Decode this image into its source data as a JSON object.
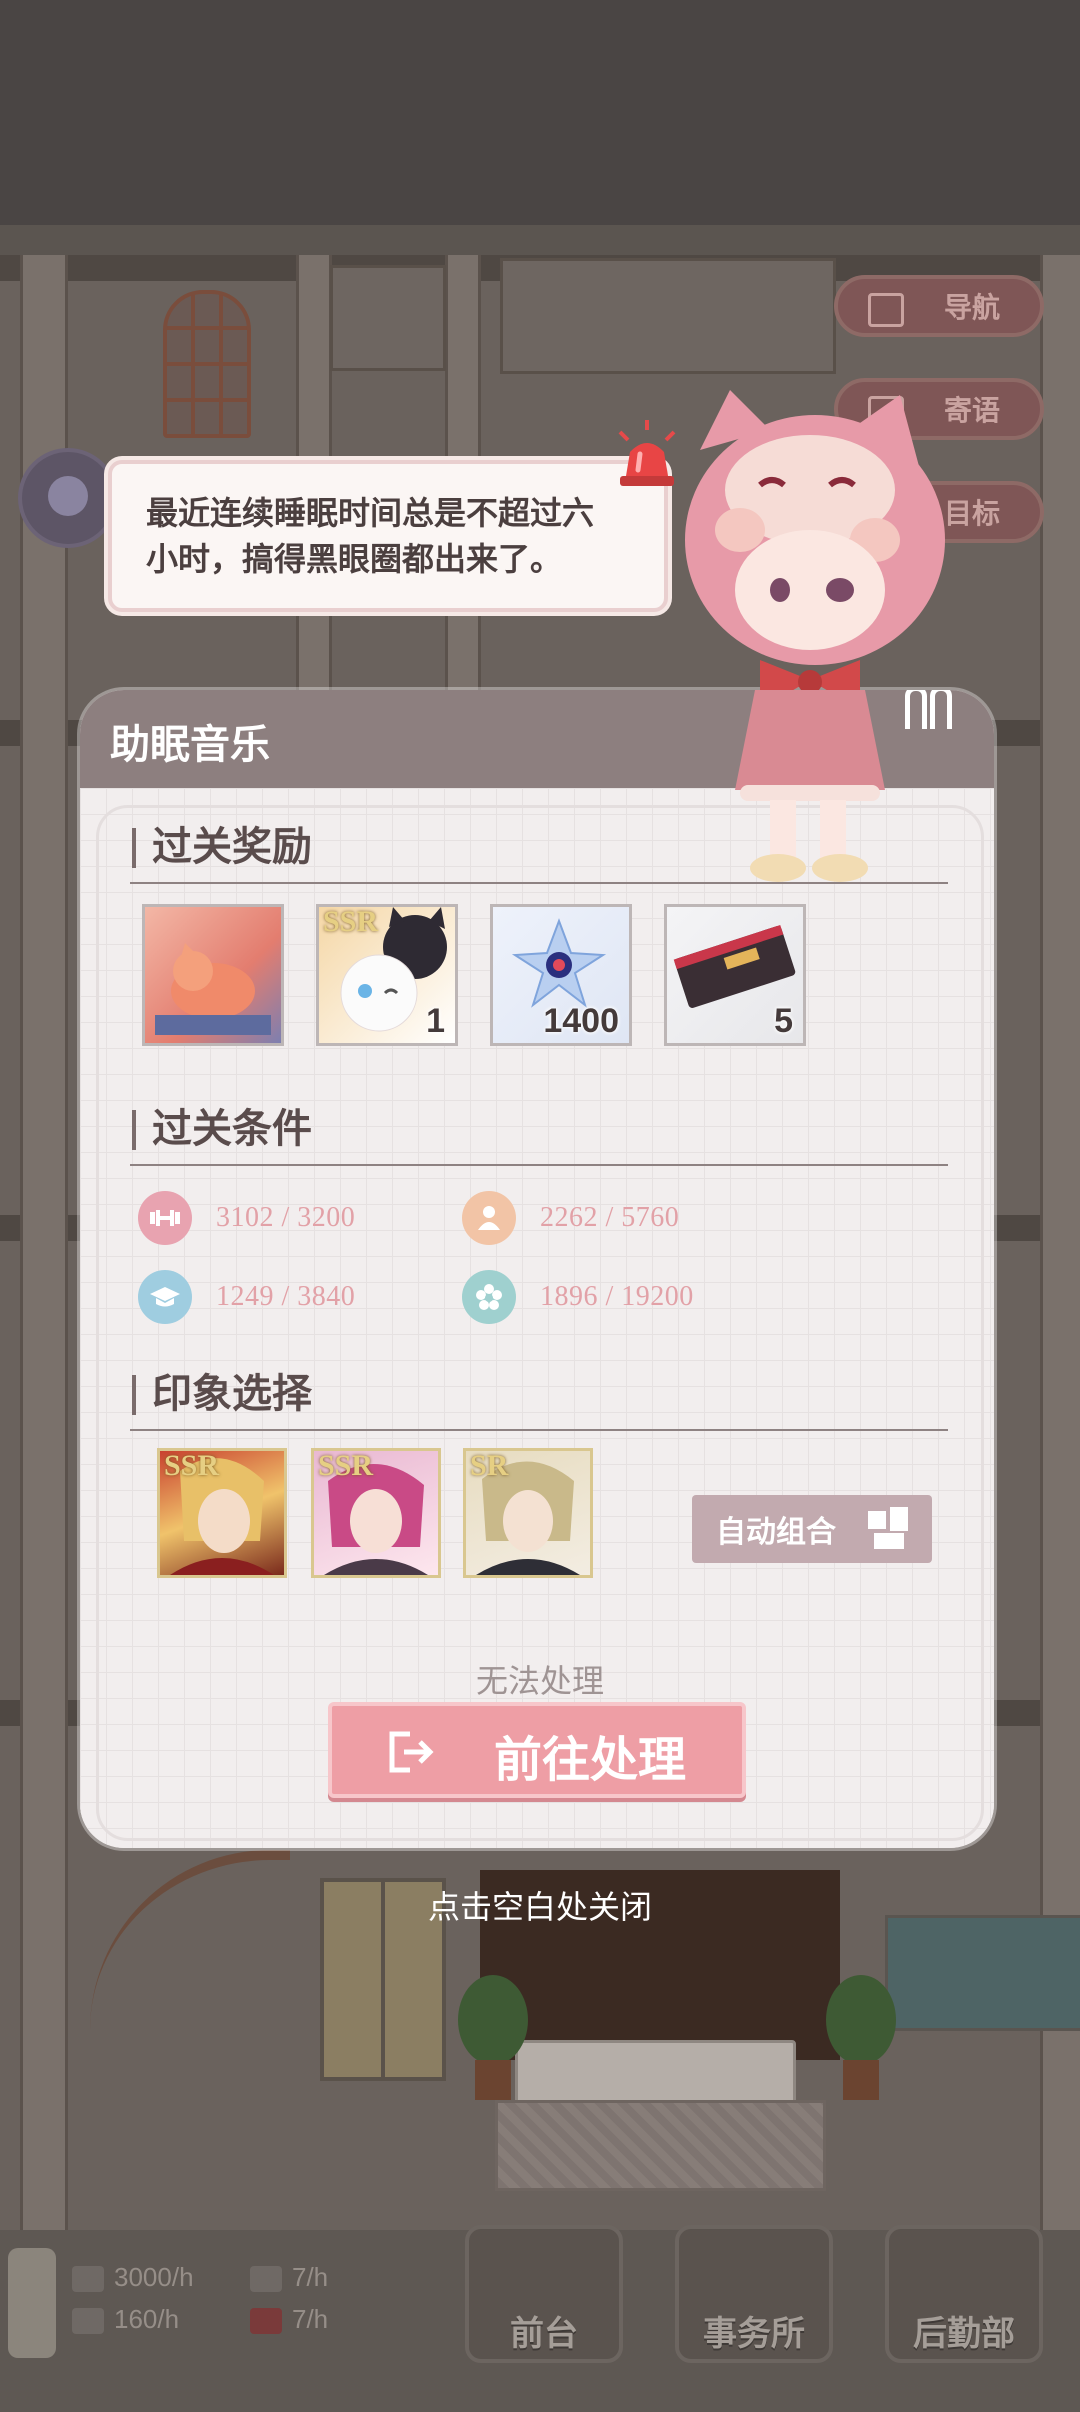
{
  "dialogue": {
    "text_line1": "最近连续睡眠时间总是不超过六",
    "text_line2": "小时，搞得黑眼圈都出来了。"
  },
  "side_nav": [
    {
      "label": "导航",
      "icon": "map-icon"
    },
    {
      "label": "寄语",
      "icon": "book-icon"
    },
    {
      "label": "目标",
      "icon": "target-icon"
    }
  ],
  "modal": {
    "title": "助眠音乐",
    "rewards_title": "过关奖励",
    "rewards": [
      {
        "name": "sleeping-cat-card",
        "count": ""
      },
      {
        "name": "ssr-cat-card",
        "badge": "SSR",
        "count": "1"
      },
      {
        "name": "crystal-flower",
        "count": "1400"
      },
      {
        "name": "ticket",
        "count": "5"
      }
    ],
    "conditions_title": "过关条件",
    "conditions": [
      {
        "icon": "dumbbell-icon",
        "color": "#e8a3b0",
        "value": "3102  / 3200"
      },
      {
        "icon": "person-icon",
        "color": "#f2c4a6",
        "value": "2262  / 5760"
      },
      {
        "icon": "graduation-cap-icon",
        "color": "#9fcde0",
        "value": "1249  / 3840"
      },
      {
        "icon": "flower-icon",
        "color": "#9fd0cf",
        "value": "1896  / 19200"
      }
    ],
    "impression_title": "印象选择",
    "cards": [
      {
        "rarity": "SSR",
        "name": "blond-character-card"
      },
      {
        "rarity": "SSR",
        "name": "pink-hair-character-card"
      },
      {
        "rarity": "SR",
        "name": "light-hair-character-card"
      }
    ],
    "auto_label": "自动组合",
    "cannot_label": "无法处理",
    "go_label": "前往处理"
  },
  "close_hint": "点击空白处关闭",
  "bottom": {
    "resources": [
      {
        "icon": "cash-icon",
        "value": "3000/h"
      },
      {
        "icon": "people-icon",
        "value": "7/h"
      },
      {
        "icon": "book-stack-icon",
        "value": "160/h"
      },
      {
        "icon": "gift-icon",
        "value": "7/h"
      }
    ],
    "buttons": [
      "前台",
      "事务所",
      "后勤部"
    ]
  },
  "colors": {
    "modal_header": "#8d7f7f",
    "accent_pink": "#ee9ea5",
    "condition_text": "#e2a1a7"
  }
}
